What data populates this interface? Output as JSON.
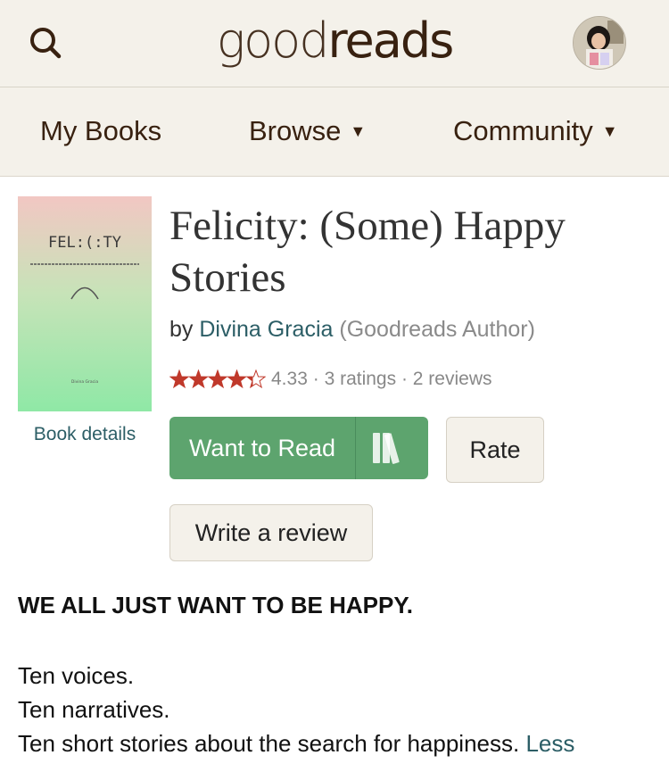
{
  "header": {
    "logo_light": "good",
    "logo_bold": "reads",
    "search_icon": "search-icon",
    "avatar_icon": "user-avatar"
  },
  "nav": {
    "items": [
      {
        "label": "My Books"
      },
      {
        "label": "Browse",
        "caret": "▼"
      },
      {
        "label": "Community",
        "caret": "▼"
      }
    ]
  },
  "book": {
    "cover": {
      "title_text": "FEL:(:TY",
      "author_text": "Divina Gracia"
    },
    "details_link": "Book details",
    "title": "Felicity: (Some) Happy Stories",
    "by": "by",
    "author": "Divina Gracia",
    "author_badge": "(Goodreads Author)",
    "rating_value": 4.33,
    "rating_text": "4.33",
    "ratings_count": "3 ratings",
    "reviews_count": "2 reviews",
    "separator": "·"
  },
  "actions": {
    "want_to_read": "Want to Read",
    "shelf_icon": "bookshelf-icon",
    "rate": "Rate",
    "write_review": "Write a review"
  },
  "description": {
    "headline": "WE ALL JUST WANT TO BE HAPPY.",
    "lines": [
      "Ten voices.",
      "Ten narratives.",
      "Ten short stories about the search for happiness."
    ],
    "less_link": "Less"
  },
  "colors": {
    "header_bg": "#f4f1ea",
    "brand_brown": "#382110",
    "link_teal": "#2c5e66",
    "button_green": "#5da46e",
    "star_red": "#c0392b"
  }
}
